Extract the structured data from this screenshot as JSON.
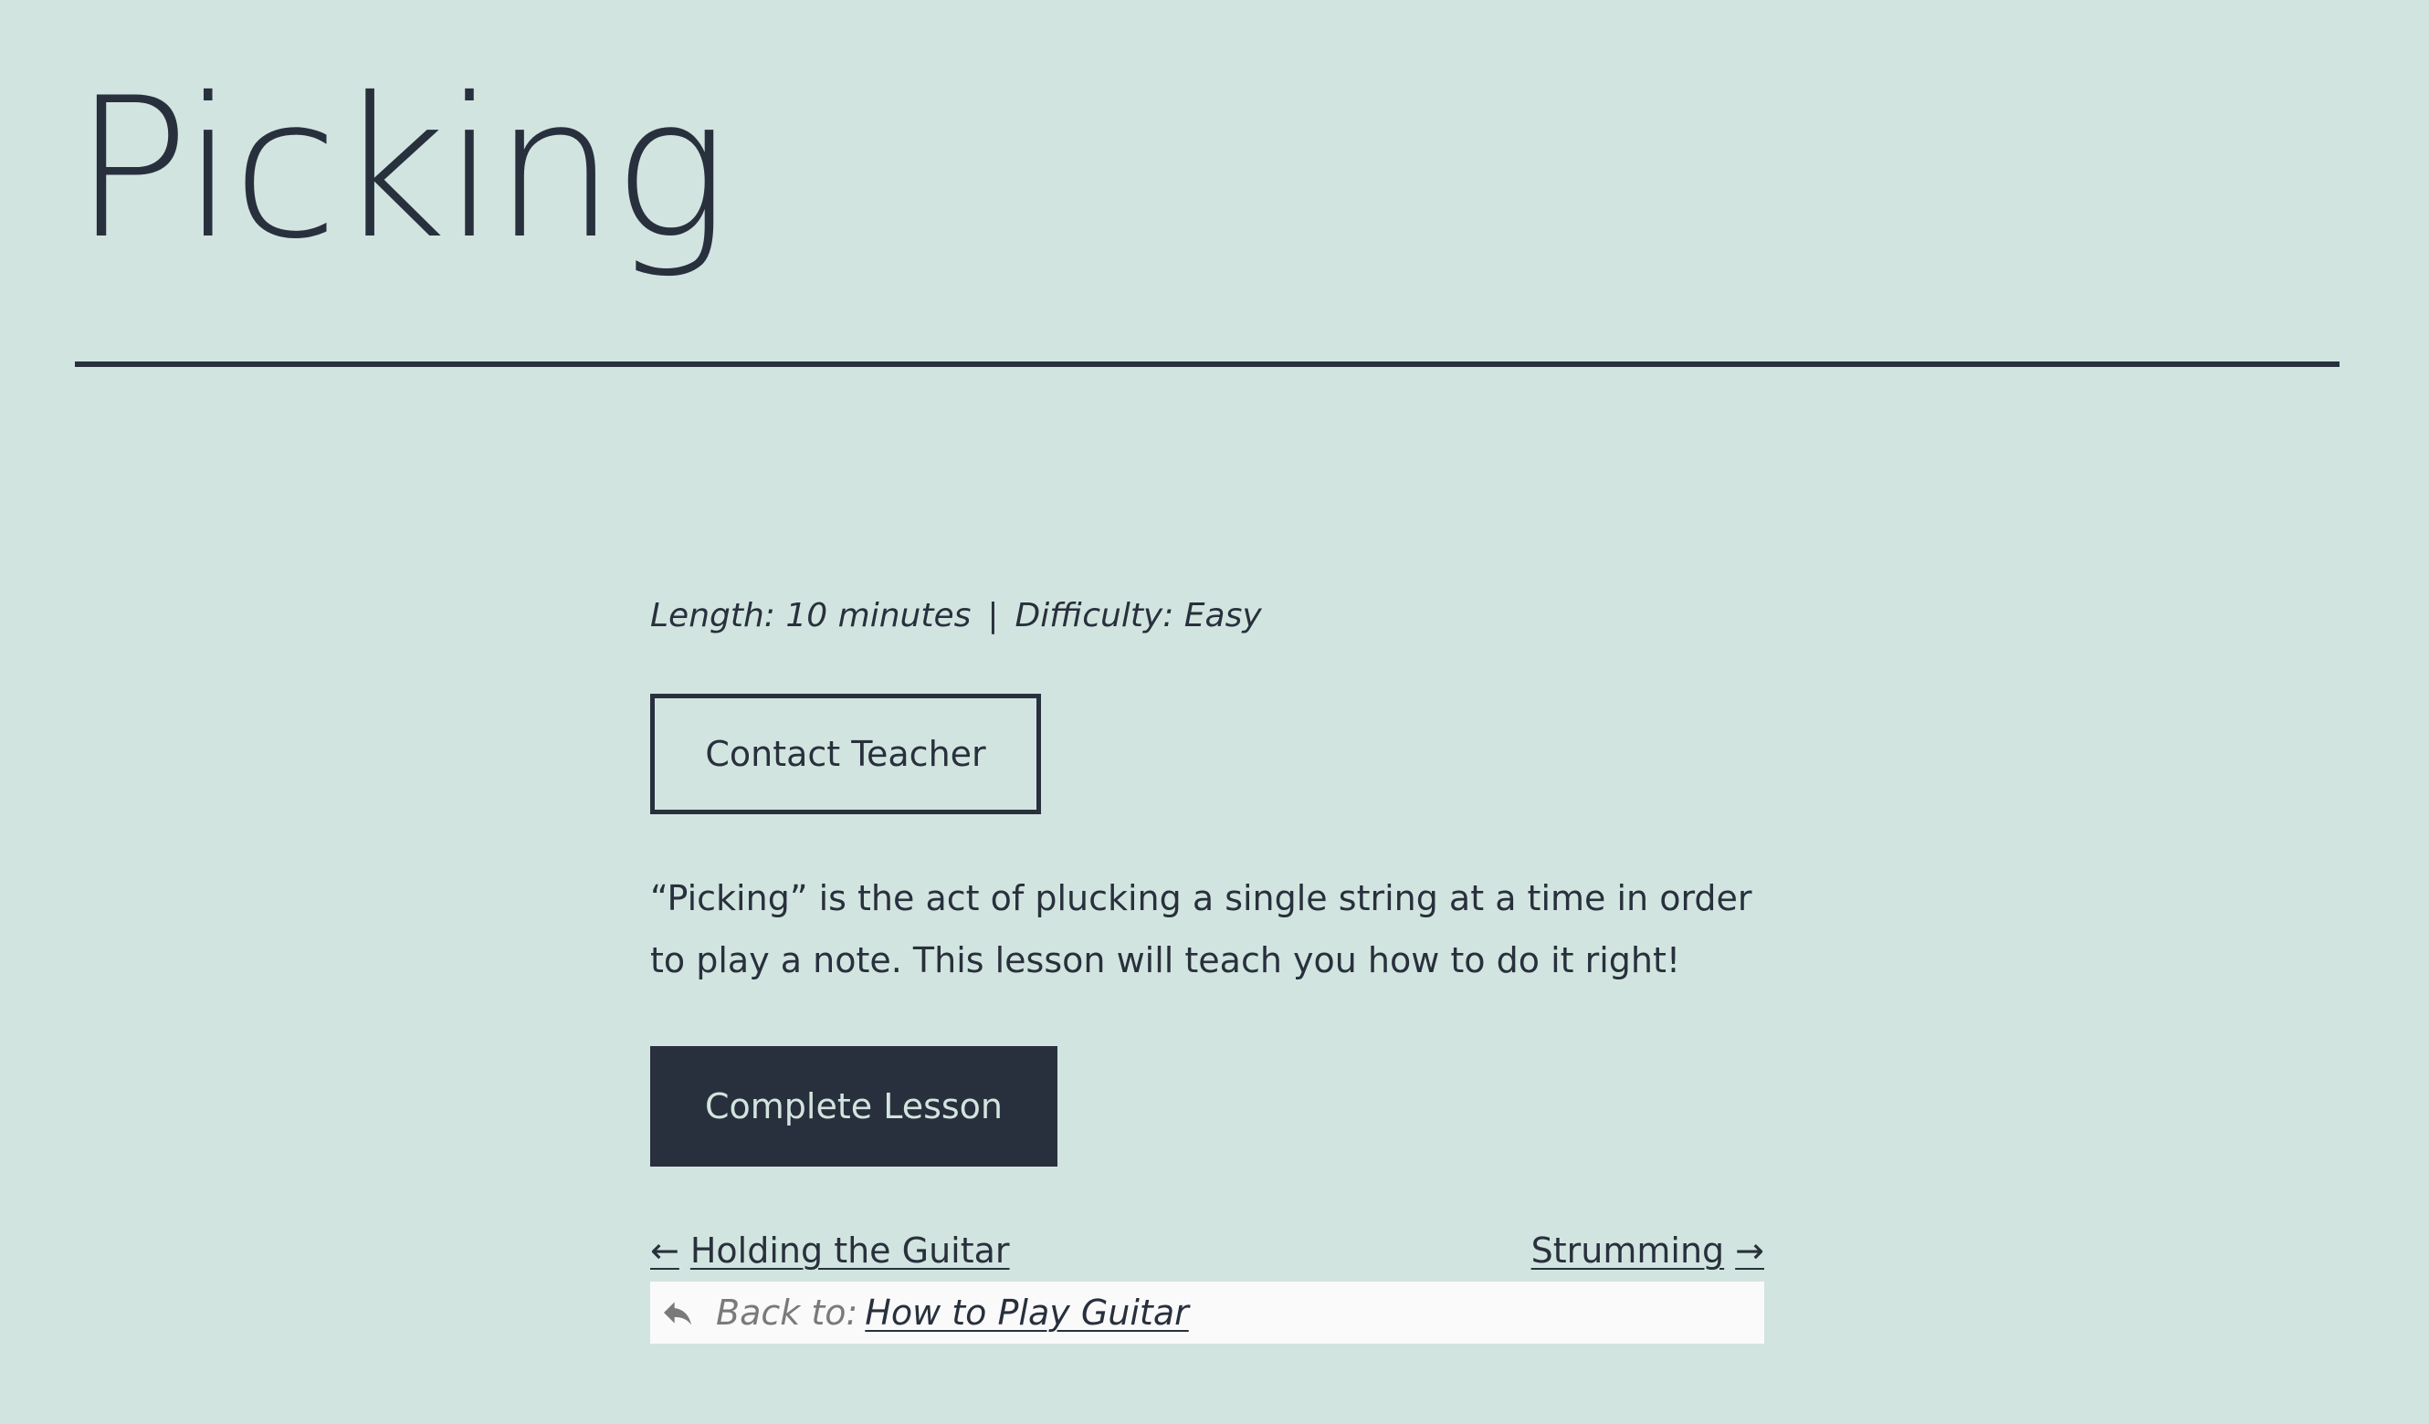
{
  "page": {
    "title": "Picking"
  },
  "lesson_meta": {
    "length": "Length: 10 minutes",
    "separator": "|",
    "difficulty": "Difficulty: Easy"
  },
  "actions": {
    "contact_label": "Contact Teacher",
    "complete_label": "Complete Lesson"
  },
  "content": {
    "intro": "“Picking” is the act of plucking a single string at a time in order to play a note. This lesson will teach you how to do it right!"
  },
  "navigation": {
    "prev_label": "Holding the Guitar",
    "prev_arrow": "←",
    "next_label": "Strumming",
    "next_arrow": "→"
  },
  "back": {
    "prefix": "Back to:",
    "course_label": "How to Play Guitar",
    "icon": "reply-arrow-icon"
  },
  "colors": {
    "background": "#d2e4df",
    "foreground": "#28303d",
    "back_bar": "#fafafa"
  }
}
